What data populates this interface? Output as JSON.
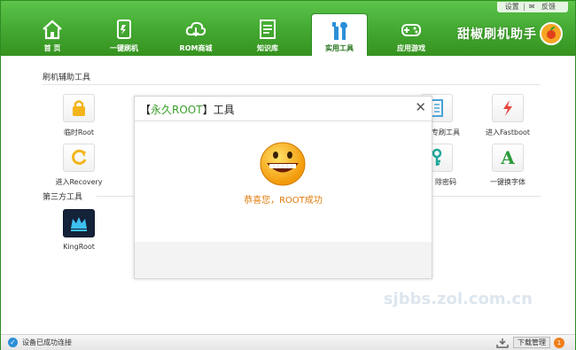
{
  "window": {
    "top_links": [
      "设置",
      "反馈"
    ],
    "brand": "甜椒刷机助手"
  },
  "tabs": [
    {
      "label": "首 页",
      "icon": "home-icon"
    },
    {
      "label": "一键刷机",
      "icon": "phone-flash-icon"
    },
    {
      "label": "ROM商城",
      "icon": "cloud-download-icon"
    },
    {
      "label": "知识库",
      "icon": "document-icon"
    },
    {
      "label": "实用工具",
      "icon": "tools-icon",
      "active": true
    },
    {
      "label": "应用游戏",
      "icon": "gamepad-icon"
    }
  ],
  "sections": {
    "helper_title": "刷机辅助工具",
    "third_party_title": "第三方工具"
  },
  "tools": {
    "temp_root": "临时Root",
    "recovery": "进入Recovery",
    "flash_tool": "专刷工具",
    "fastboot": "进入Fastboot",
    "unlock": "除密码",
    "font": "一键换字体",
    "kingroot": "KingRoot"
  },
  "dialog": {
    "title_bracket_open": "【",
    "title_accent": "永久ROOT",
    "title_bracket_close": "】",
    "title_suffix": "工具",
    "close": "✕",
    "message": "恭喜您，ROOT成功"
  },
  "watermark": "sjbbs.zol.com.cn",
  "status": {
    "connection": "设备已成功连接",
    "download_label": "下载管理",
    "download_count": "1"
  },
  "colors": {
    "header_green": "#46ac35",
    "accent_orange": "#e07b0c",
    "status_blue": "#2b8fd8"
  }
}
